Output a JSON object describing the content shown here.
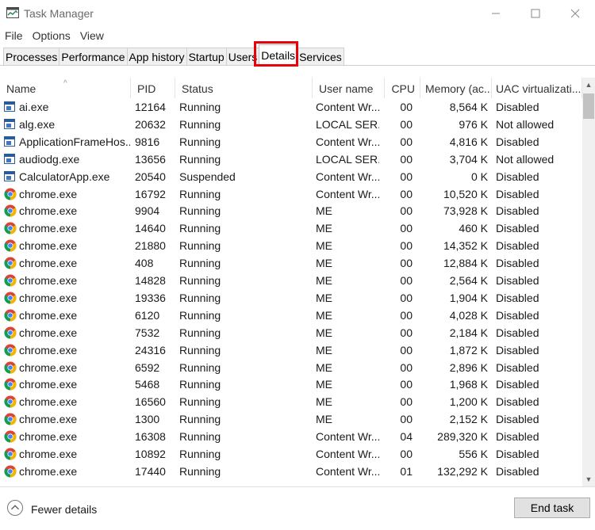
{
  "window": {
    "title": "Task Manager"
  },
  "menu": [
    "File",
    "Options",
    "View"
  ],
  "tabs": [
    "Processes",
    "Performance",
    "App history",
    "Startup",
    "Users",
    "Details",
    "Services"
  ],
  "active_tab": "Details",
  "columns": [
    "Name",
    "PID",
    "Status",
    "User name",
    "CPU",
    "Memory (ac...",
    "UAC virtualizati..."
  ],
  "rows": [
    {
      "icon": "app-window-icon",
      "name": "ai.exe",
      "pid": "12164",
      "status": "Running",
      "user": "Content Wr...",
      "cpu": "00",
      "mem": "8,564 K",
      "uac": "Disabled"
    },
    {
      "icon": "app-window-icon",
      "name": "alg.exe",
      "pid": "20632",
      "status": "Running",
      "user": "LOCAL SER...",
      "cpu": "00",
      "mem": "976 K",
      "uac": "Not allowed"
    },
    {
      "icon": "app-window-icon",
      "name": "ApplicationFrameHos...",
      "pid": "9816",
      "status": "Running",
      "user": "Content Wr...",
      "cpu": "00",
      "mem": "4,816 K",
      "uac": "Disabled"
    },
    {
      "icon": "app-window-icon",
      "name": "audiodg.exe",
      "pid": "13656",
      "status": "Running",
      "user": "LOCAL SER...",
      "cpu": "00",
      "mem": "3,704 K",
      "uac": "Not allowed"
    },
    {
      "icon": "app-window-icon",
      "name": "CalculatorApp.exe",
      "pid": "20540",
      "status": "Suspended",
      "user": "Content Wr...",
      "cpu": "00",
      "mem": "0 K",
      "uac": "Disabled"
    },
    {
      "icon": "chrome-icon",
      "name": "chrome.exe",
      "pid": "16792",
      "status": "Running",
      "user": "Content Wr...",
      "cpu": "00",
      "mem": "10,520 K",
      "uac": "Disabled"
    },
    {
      "icon": "chrome-icon",
      "name": "chrome.exe",
      "pid": "9904",
      "status": "Running",
      "user": "ME",
      "cpu": "00",
      "mem": "73,928 K",
      "uac": "Disabled"
    },
    {
      "icon": "chrome-icon",
      "name": "chrome.exe",
      "pid": "14640",
      "status": "Running",
      "user": "ME",
      "cpu": "00",
      "mem": "460 K",
      "uac": "Disabled"
    },
    {
      "icon": "chrome-icon",
      "name": "chrome.exe",
      "pid": "21880",
      "status": "Running",
      "user": "ME",
      "cpu": "00",
      "mem": "14,352 K",
      "uac": "Disabled"
    },
    {
      "icon": "chrome-icon",
      "name": "chrome.exe",
      "pid": "408",
      "status": "Running",
      "user": "ME",
      "cpu": "00",
      "mem": "12,884 K",
      "uac": "Disabled"
    },
    {
      "icon": "chrome-icon",
      "name": "chrome.exe",
      "pid": "14828",
      "status": "Running",
      "user": "ME",
      "cpu": "00",
      "mem": "2,564 K",
      "uac": "Disabled"
    },
    {
      "icon": "chrome-icon",
      "name": "chrome.exe",
      "pid": "19336",
      "status": "Running",
      "user": "ME",
      "cpu": "00",
      "mem": "1,904 K",
      "uac": "Disabled"
    },
    {
      "icon": "chrome-icon",
      "name": "chrome.exe",
      "pid": "6120",
      "status": "Running",
      "user": "ME",
      "cpu": "00",
      "mem": "4,028 K",
      "uac": "Disabled"
    },
    {
      "icon": "chrome-icon",
      "name": "chrome.exe",
      "pid": "7532",
      "status": "Running",
      "user": "ME",
      "cpu": "00",
      "mem": "2,184 K",
      "uac": "Disabled"
    },
    {
      "icon": "chrome-icon",
      "name": "chrome.exe",
      "pid": "24316",
      "status": "Running",
      "user": "ME",
      "cpu": "00",
      "mem": "1,872 K",
      "uac": "Disabled"
    },
    {
      "icon": "chrome-icon",
      "name": "chrome.exe",
      "pid": "6592",
      "status": "Running",
      "user": "ME",
      "cpu": "00",
      "mem": "2,896 K",
      "uac": "Disabled"
    },
    {
      "icon": "chrome-icon",
      "name": "chrome.exe",
      "pid": "5468",
      "status": "Running",
      "user": "ME",
      "cpu": "00",
      "mem": "1,968 K",
      "uac": "Disabled"
    },
    {
      "icon": "chrome-icon",
      "name": "chrome.exe",
      "pid": "16560",
      "status": "Running",
      "user": "ME",
      "cpu": "00",
      "mem": "1,200 K",
      "uac": "Disabled"
    },
    {
      "icon": "chrome-icon",
      "name": "chrome.exe",
      "pid": "1300",
      "status": "Running",
      "user": "ME",
      "cpu": "00",
      "mem": "2,152 K",
      "uac": "Disabled"
    },
    {
      "icon": "chrome-icon",
      "name": "chrome.exe",
      "pid": "16308",
      "status": "Running",
      "user": "Content Wr...",
      "cpu": "04",
      "mem": "289,320 K",
      "uac": "Disabled"
    },
    {
      "icon": "chrome-icon",
      "name": "chrome.exe",
      "pid": "10892",
      "status": "Running",
      "user": "Content Wr...",
      "cpu": "00",
      "mem": "556 K",
      "uac": "Disabled"
    },
    {
      "icon": "chrome-icon",
      "name": "chrome.exe",
      "pid": "17440",
      "status": "Running",
      "user": "Content Wr...",
      "cpu": "01",
      "mem": "132,292 K",
      "uac": "Disabled"
    }
  ],
  "footer": {
    "fewer_details": "Fewer details",
    "end_task": "End task"
  },
  "colors": {
    "highlight": "#e8000b",
    "chrome_red": "#db4437",
    "chrome_yellow": "#f4b400",
    "chrome_green": "#0f9d58",
    "chrome_blue": "#4285f4"
  }
}
